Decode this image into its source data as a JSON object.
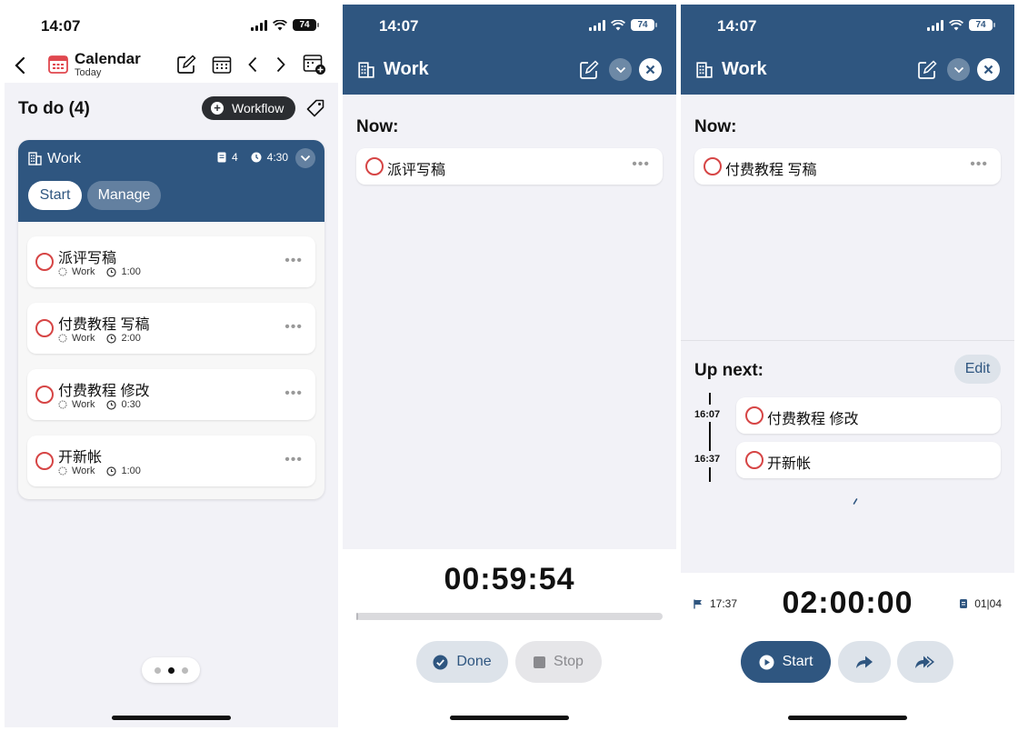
{
  "status": {
    "time": "14:07",
    "battery": "74"
  },
  "calendar_screen": {
    "title": "Calendar",
    "subtitle": "Today",
    "todo_heading": "To do (4)",
    "workflow_button": "Workflow",
    "group": {
      "title": "Work",
      "task_count": "4",
      "total_time": "4:30",
      "start_label": "Start",
      "manage_label": "Manage"
    },
    "tasks": [
      {
        "name": "派评写稿",
        "tag": "Work",
        "duration": "1:00"
      },
      {
        "name": "付费教程 写稿",
        "tag": "Work",
        "duration": "2:00"
      },
      {
        "name": "付费教程 修改",
        "tag": "Work",
        "duration": "0:30"
      },
      {
        "name": "开新帐",
        "tag": "Work",
        "duration": "1:00"
      }
    ],
    "pager": {
      "pages": 3,
      "active": 2
    }
  },
  "running_screen": {
    "title": "Work",
    "now_label": "Now:",
    "now_task": "派评写稿",
    "timer": "00:59:54",
    "progress": 0.0017,
    "done_label": "Done",
    "stop_label": "Stop"
  },
  "next_screen": {
    "title": "Work",
    "now_label": "Now:",
    "now_task": "付费教程 写稿",
    "up_next_label": "Up next:",
    "edit_label": "Edit",
    "up_next": [
      {
        "time": "16:07",
        "name": "付费教程 修改"
      },
      {
        "time": "16:37",
        "name": "开新帐"
      }
    ],
    "end_time": "17:37",
    "timer": "02:00:00",
    "position": "01|04",
    "start_label": "Start"
  },
  "colors": {
    "accent": "#2f5680",
    "ring": "#d64545"
  }
}
